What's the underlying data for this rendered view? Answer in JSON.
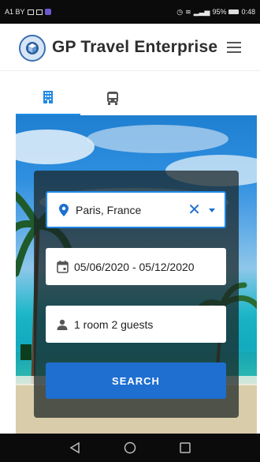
{
  "status_bar": {
    "left_text": "A1 BY",
    "battery_text": "95%",
    "time": "0:48"
  },
  "header": {
    "title": "GP Travel Enterprise",
    "logo_icon": "globe-logo-icon",
    "menu_icon": "hamburger-menu-icon"
  },
  "tabs": [
    {
      "name": "hotels",
      "icon": "building-icon",
      "active": true
    },
    {
      "name": "buses",
      "icon": "bus-icon",
      "active": false
    }
  ],
  "search": {
    "destination": "Paris, France",
    "dates": "05/06/2020 - 05/12/2020",
    "guests": "1 room 2 guests",
    "button_label": "SEARCH"
  },
  "colors": {
    "accent": "#1e88e5",
    "button": "#1e6fd0",
    "card_overlay": "#192323"
  },
  "nav": {
    "icons": [
      "back-triangle-icon",
      "home-circle-icon",
      "recents-square-icon"
    ]
  }
}
